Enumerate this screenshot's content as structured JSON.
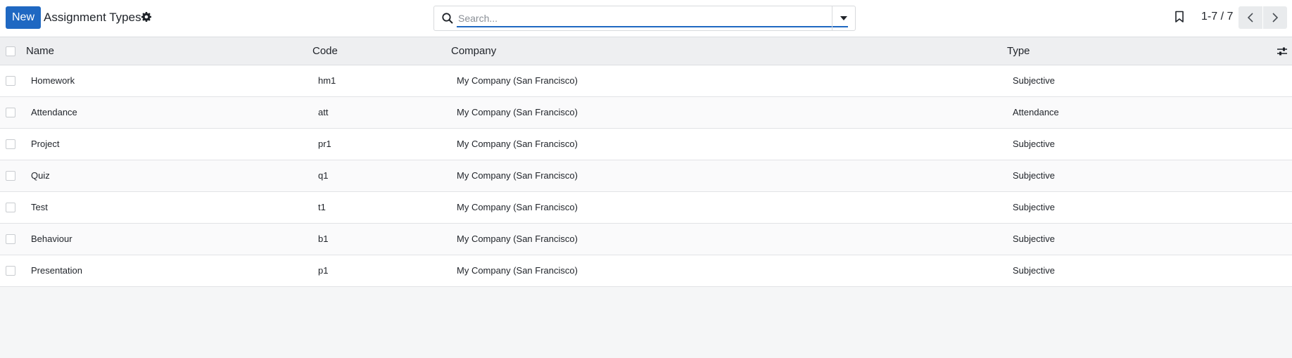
{
  "toolbar": {
    "new_label": "New",
    "title": "Assignment Types",
    "settings_icon": "gear-icon"
  },
  "search": {
    "placeholder": "Search...",
    "value": "",
    "icon": "search-icon",
    "toggle_icon": "caret-down-icon"
  },
  "pager": {
    "favorite_icon": "bookmark-icon",
    "value": "1-7 / 7",
    "prev_icon": "chevron-left-icon",
    "next_icon": "chevron-right-icon"
  },
  "table": {
    "columns": {
      "name": "Name",
      "code": "Code",
      "company": "Company",
      "type": "Type"
    },
    "settings_icon": "sliders-icon",
    "rows": [
      {
        "name": "Homework",
        "code": "hm1",
        "company": "My Company (San Francisco)",
        "type": "Subjective"
      },
      {
        "name": "Attendance",
        "code": "att",
        "company": "My Company (San Francisco)",
        "type": "Attendance"
      },
      {
        "name": "Project",
        "code": "pr1",
        "company": "My Company (San Francisco)",
        "type": "Subjective"
      },
      {
        "name": "Quiz",
        "code": "q1",
        "company": "My Company (San Francisco)",
        "type": "Subjective"
      },
      {
        "name": "Test",
        "code": "t1",
        "company": "My Company (San Francisco)",
        "type": "Subjective"
      },
      {
        "name": "Behaviour",
        "code": "b1",
        "company": "My Company (San Francisco)",
        "type": "Subjective"
      },
      {
        "name": "Presentation",
        "code": "p1",
        "company": "My Company (San Francisco)",
        "type": "Subjective"
      }
    ]
  },
  "colors": {
    "accent": "#1f68c2",
    "header_bg": "#eeeff1",
    "page_bg": "#f5f6f7"
  }
}
